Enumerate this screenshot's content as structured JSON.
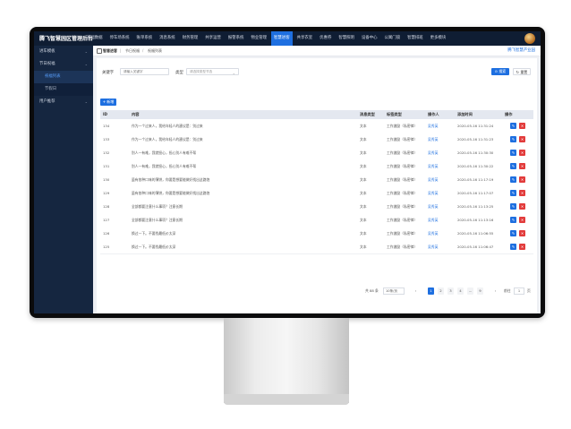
{
  "app": {
    "title": "腾飞智慧园区管理后台"
  },
  "topnav": [
    {
      "label": "基础数据"
    },
    {
      "label": "停车场系统"
    },
    {
      "label": "账单系统"
    },
    {
      "label": "消息系统"
    },
    {
      "label": "财务管理"
    },
    {
      "label": "共享运营"
    },
    {
      "label": "报警系统"
    },
    {
      "label": "物业管理"
    },
    {
      "label": "智慧进客"
    },
    {
      "label": "共享衣室"
    },
    {
      "label": "优惠券"
    },
    {
      "label": "智慧照明"
    },
    {
      "label": "设备中心"
    },
    {
      "label": "公寓门锁"
    },
    {
      "label": "智慧排班"
    },
    {
      "label": "更多模块"
    }
  ],
  "topnav_active_index": 8,
  "sidebar": {
    "items": [
      {
        "label": "进车模板",
        "expandable": true
      },
      {
        "label": "节日祝福",
        "expandable": true
      },
      {
        "label": "祝福列表",
        "sub": true,
        "active": true
      },
      {
        "label": "节假日",
        "sub": true,
        "active": false
      },
      {
        "label": "用户推荐",
        "expandable": true
      }
    ]
  },
  "breadcrumb": {
    "items": [
      "智慧进客",
      "节日祝福",
      "祝福列表"
    ],
    "right_link": "腾飞智慧产业园"
  },
  "filters": {
    "keyword_label": "关键字",
    "keyword_placeholder": "请输入关键字",
    "type_label": "类型",
    "type_placeholder": "请选择类型节选",
    "search_button": "搜索",
    "reset_button": "重置"
  },
  "actions": {
    "add_button": "+ 新增"
  },
  "table": {
    "headers": [
      "ID",
      "内容",
      "消息类型",
      "标签类型",
      "操作人",
      "添加时间",
      "操作"
    ],
    "rows": [
      {
        "id": "134",
        "content": "作为一个过来人，我给年轻人的建议是：别过来",
        "msg_type": "文本",
        "tag_type": "工作激励（私密律）",
        "operator": "吴秀英",
        "time": "2020-05-16 11:31:24"
      },
      {
        "id": "133",
        "content": "作为一个过来人，我给年轻人的建议是：别过来",
        "msg_type": "文本",
        "tag_type": "工作激励（私密律）",
        "operator": "吴秀英",
        "time": "2020-05-16 11:31:23"
      },
      {
        "id": "132",
        "content": "别人一有难，我就担心，担心别人有难不帮",
        "msg_type": "文本",
        "tag_type": "工作激励（私密律）",
        "operator": "吴秀英",
        "time": "2020-05-16 11:30:30"
      },
      {
        "id": "131",
        "content": "别人一有难，我就担心，担心别人有难不帮",
        "msg_type": "文本",
        "tag_type": "工作激励（私密律）",
        "operator": "吴秀英",
        "time": "2020-05-16 11:30:22"
      },
      {
        "id": "130",
        "content": "虽有各种口味的薄饼，你要是想要能做好找出这路饱",
        "msg_type": "文本",
        "tag_type": "工作激励（私密律）",
        "operator": "吴秀英",
        "time": "2020-05-16 11:17:19"
      },
      {
        "id": "129",
        "content": "虽有各种口味的薄饼，你要是想要能做好找出这路饱",
        "msg_type": "文本",
        "tag_type": "工作激励（私密律）",
        "operator": "吴秀英",
        "time": "2020-05-16 11:17:07"
      },
      {
        "id": "128",
        "content": "全部都要注意什么事项？注意长期",
        "msg_type": "文本",
        "tag_type": "工作激励（私密律）",
        "operator": "吴秀英",
        "time": "2020-05-16 11:13:25"
      },
      {
        "id": "127",
        "content": "全部都要注意什么事项？注意长期",
        "msg_type": "文本",
        "tag_type": "工作激励（私密律）",
        "operator": "吴秀英",
        "time": "2020-05-16 11:13:16"
      },
      {
        "id": "126",
        "content": "换过一下。不要找最低价太深",
        "msg_type": "文本",
        "tag_type": "工作激励（私密律）",
        "operator": "吴秀英",
        "time": "2020-05-16 11:06:55"
      },
      {
        "id": "125",
        "content": "换过一下。不要找最低价太深",
        "msg_type": "文本",
        "tag_type": "工作激励（私密律）",
        "operator": "吴秀英",
        "time": "2020-05-16 11:06:47"
      }
    ]
  },
  "pagination": {
    "total_text": "共 88 条",
    "page_size": "10条/页",
    "pages": [
      "1",
      "2",
      "3",
      "4",
      "...",
      "9"
    ],
    "current": "1",
    "prev": "‹",
    "next": "›",
    "goto_label": "前往",
    "goto_value": "1",
    "page_suffix": "页"
  },
  "colors": {
    "accent": "#1e6fe0",
    "danger": "#e23b3b",
    "topbar": "#0f1d33",
    "sidebar": "#152640"
  },
  "icons": {
    "edit": "edit-icon",
    "delete": "delete-icon",
    "search": "search-icon",
    "reset": "reset-icon",
    "avatar": "avatar"
  }
}
